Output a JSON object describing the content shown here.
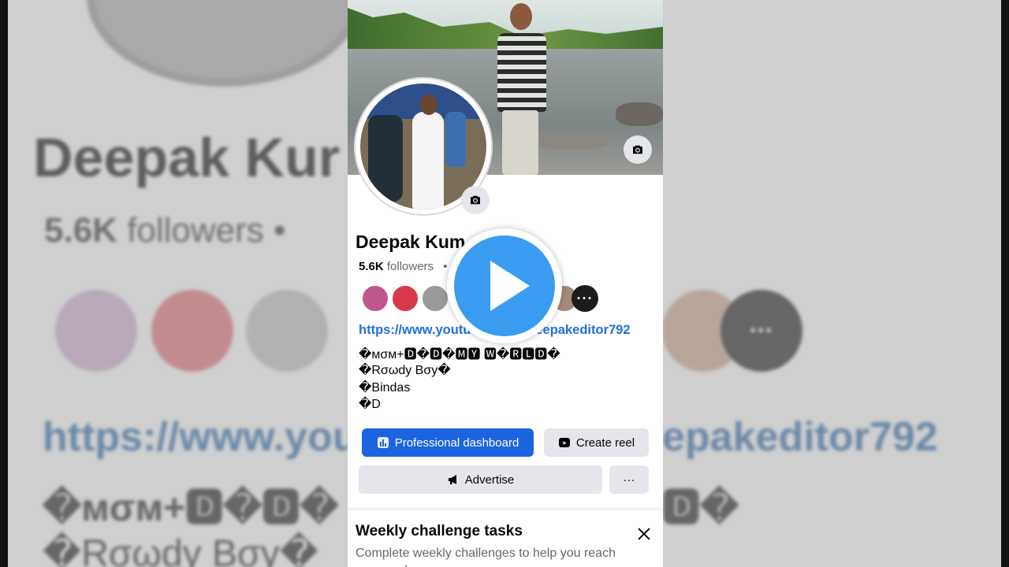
{
  "profile": {
    "name": "Deepak Kum",
    "followers_count": "5.6K",
    "followers_label": "followers",
    "followers_dot": "•",
    "link": "https://www.youtub",
    "link_tail": "Deepakeditor792",
    "bio_lines": [
      "�мσм+🅳�🅳�🅼🆈 🆆�🆁🅻🅳�",
      "�Rσωdу Bσу�",
      "�Bindas",
      "�D"
    ]
  },
  "friends": {
    "more_label": "···",
    "colors": [
      "#c0578c",
      "#d8394a",
      "#9a9a9a",
      "#7a6f6a",
      "#a48a7a"
    ]
  },
  "buttons": {
    "dashboard": "Professional dashboard",
    "create_reel": "Create reel",
    "advertise": "Advertise",
    "more": "···"
  },
  "weekly": {
    "title": "Weekly challenge tasks",
    "desc": "Complete weekly challenges to help you reach your goals"
  },
  "backdrop": {
    "name": "Deepak Kur",
    "followers_count": "5.6K",
    "followers_label": "followers",
    "followers_dot": "•",
    "link_left": "https://www.you",
    "link_right": "epakeditor792",
    "line1": "�мσм+🅳�🅳�",
    "line1_right": "🅳�",
    "line2": "�Rσωdу Bσу�",
    "more_label": "···"
  },
  "colors": {
    "accent": "#1b64e0",
    "link": "#216fdb",
    "play": "#3a9cf0"
  }
}
